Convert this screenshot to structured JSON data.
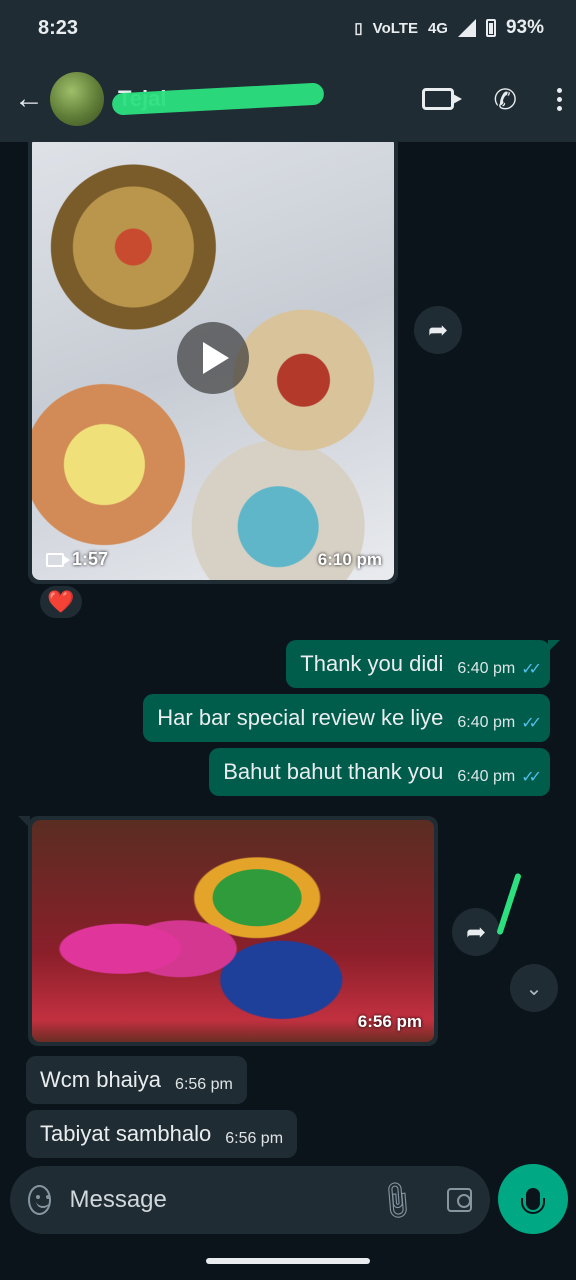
{
  "status_bar": {
    "time": "8:23",
    "network": "4G",
    "volte": "VoLTE",
    "battery": "93%"
  },
  "header": {
    "contact_name": "Tejal"
  },
  "messages": {
    "video": {
      "duration": "1:57",
      "time": "6:10 pm",
      "reaction": "❤️"
    },
    "out_1": {
      "text": "Thank you didi",
      "time": "6:40 pm"
    },
    "out_2": {
      "text": "Har bar special review ke liye",
      "time": "6:40 pm"
    },
    "out_3": {
      "text": "Bahut bahut thank you",
      "time": "6:40 pm"
    },
    "photo": {
      "time": "6:56 pm"
    },
    "in_1": {
      "text": "Wcm bhaiya",
      "time": "6:56 pm"
    },
    "in_2": {
      "text": "Tabiyat sambhalo",
      "time": "6:56 pm"
    }
  },
  "input": {
    "placeholder": "Message"
  },
  "colors": {
    "background": "#0b141a",
    "header": "#1f2c34",
    "outgoing_bubble": "#005c4b",
    "incoming_bubble": "#202c33",
    "accent": "#00a884",
    "read_ticks": "#53bdeb"
  }
}
